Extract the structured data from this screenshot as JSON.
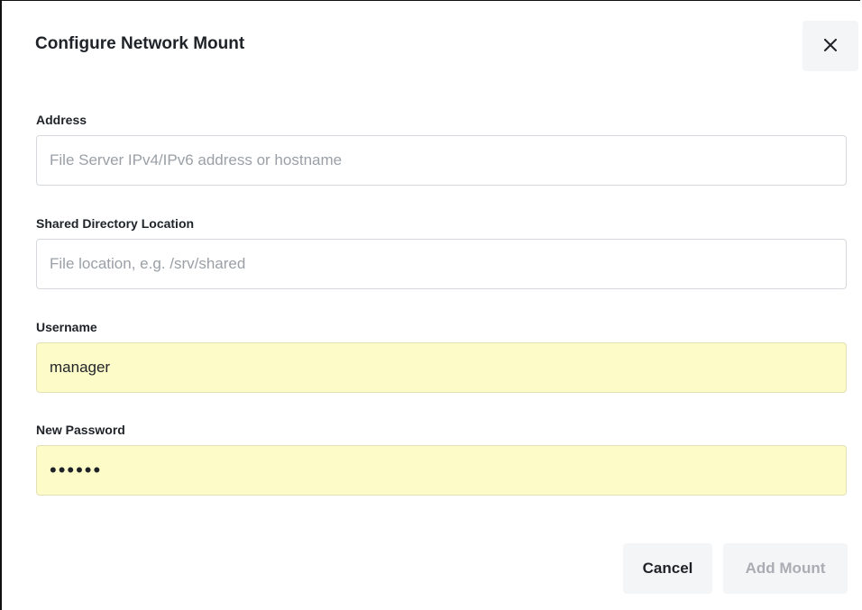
{
  "dialog": {
    "title": "Configure Network Mount",
    "close_icon": "close-icon"
  },
  "fields": {
    "address": {
      "label": "Address",
      "value": "",
      "placeholder": "File Server IPv4/IPv6 address or hostname"
    },
    "shared_directory": {
      "label": "Shared Directory Location",
      "value": "",
      "placeholder": "File location, e.g. /srv/shared"
    },
    "username": {
      "label": "Username",
      "value": "manager",
      "placeholder": ""
    },
    "password": {
      "label": "New Password",
      "value": "••••••",
      "placeholder": ""
    }
  },
  "actions": {
    "cancel_label": "Cancel",
    "add_label": "Add Mount",
    "add_enabled": false
  },
  "colors": {
    "autofill_background": "#fdfbc8",
    "button_background": "#f4f5f7",
    "disabled_text": "#a9adb3"
  }
}
